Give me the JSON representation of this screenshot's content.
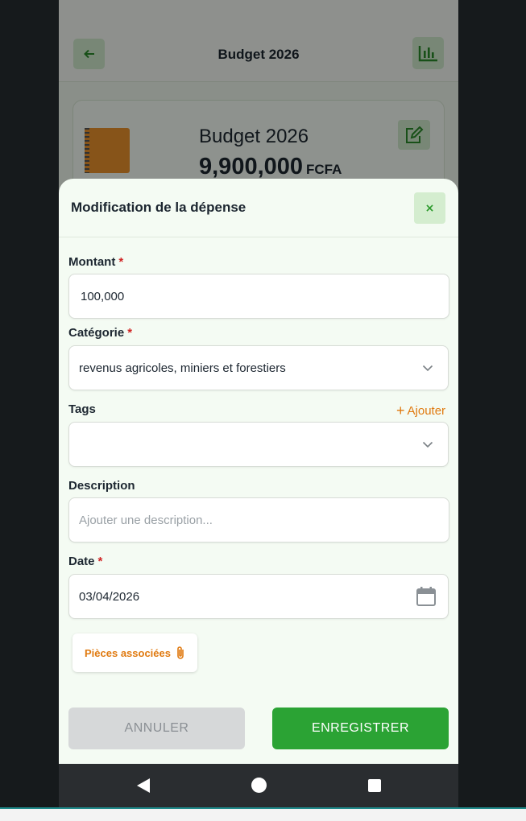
{
  "appbar": {
    "title": "Budget 2026"
  },
  "budget_card": {
    "name": "Budget 2026",
    "amount": "9,900,000",
    "currency": "FCFA"
  },
  "modal": {
    "title": "Modification de la dépense",
    "close_label": "×",
    "fields": {
      "montant": {
        "label": "Montant",
        "required_mark": "*",
        "value": "100,000"
      },
      "categorie": {
        "label": "Catégorie",
        "required_mark": "*",
        "value": "revenus agricoles, miniers et forestiers"
      },
      "tags": {
        "label": "Tags",
        "add_label": "Ajouter",
        "value": ""
      },
      "description": {
        "label": "Description",
        "placeholder": "Ajouter une description..."
      },
      "date": {
        "label": "Date",
        "required_mark": "*",
        "value": "03/04/2026"
      }
    },
    "attachments_label": "Pièces associées",
    "cancel_label": "ANNULER",
    "save_label": "ENREGISTRER"
  },
  "colors": {
    "accent_green": "#2ba334",
    "accent_orange": "#e07a10",
    "required_red": "#d02424"
  },
  "icons": [
    "arrow-left-icon",
    "bar-chart-icon",
    "notebook-icon",
    "edit-icon",
    "close-icon",
    "chevron-down-icon",
    "plus-icon",
    "calendar-icon",
    "paperclip-icon",
    "nav-back-icon",
    "nav-home-icon",
    "nav-recents-icon"
  ]
}
